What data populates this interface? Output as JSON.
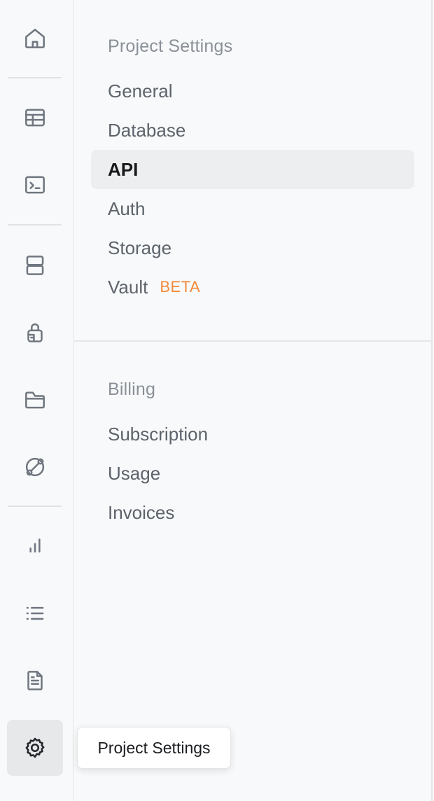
{
  "sidebar": {
    "icons": [
      {
        "name": "home-icon",
        "label": "Home"
      },
      {
        "name": "table-icon",
        "label": "Table Editor"
      },
      {
        "name": "terminal-icon",
        "label": "SQL Editor"
      },
      {
        "name": "database-icon",
        "label": "Database"
      },
      {
        "name": "lock-icon",
        "label": "Authentication"
      },
      {
        "name": "folder-icon",
        "label": "Storage"
      },
      {
        "name": "globe-icon",
        "label": "Realtime"
      },
      {
        "name": "bar-chart-icon",
        "label": "Reports"
      },
      {
        "name": "list-icon",
        "label": "Logs"
      },
      {
        "name": "document-icon",
        "label": "API Docs"
      },
      {
        "name": "gear-icon",
        "label": "Project Settings",
        "active": true
      }
    ]
  },
  "settings_menu": {
    "project_section": {
      "title": "Project Settings",
      "items": [
        {
          "label": "General"
        },
        {
          "label": "Database"
        },
        {
          "label": "API",
          "active": true
        },
        {
          "label": "Auth"
        },
        {
          "label": "Storage"
        },
        {
          "label": "Vault",
          "badge": "BETA"
        }
      ]
    },
    "billing_section": {
      "title": "Billing",
      "items": [
        {
          "label": "Subscription"
        },
        {
          "label": "Usage"
        },
        {
          "label": "Invoices"
        }
      ]
    }
  },
  "tooltip": {
    "text": "Project Settings"
  },
  "colors": {
    "background": "#f8f9fa",
    "active_item": "#eceef0",
    "beta_badge": "#f28a3c",
    "muted_text": "#5d636b"
  }
}
